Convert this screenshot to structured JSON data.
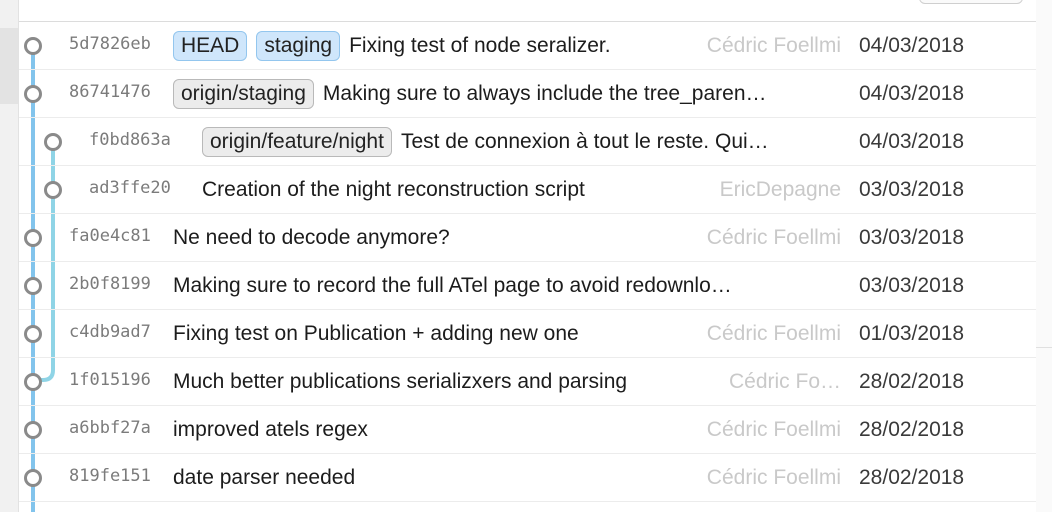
{
  "colors": {
    "lane_main": "#82c4ec",
    "lane_branch": "#8fd4e6",
    "node_stroke": "#8a8a8a",
    "badge_local_bg": "#cfe6fb",
    "badge_remote_bg": "#ececec"
  },
  "commits": [
    {
      "hash": "5d7826eb",
      "refs": [
        {
          "label": "HEAD",
          "kind": "local"
        },
        {
          "label": "staging",
          "kind": "local"
        }
      ],
      "message": "Fixing test of node seralizer.",
      "author": "Cédric Foellmi",
      "date": "04/03/2018",
      "lane": 0
    },
    {
      "hash": "86741476",
      "refs": [
        {
          "label": "origin/staging",
          "kind": "remote"
        }
      ],
      "message": "Making sure to always include the tree_paren…",
      "author": "",
      "date": "04/03/2018",
      "lane": 0
    },
    {
      "hash": "f0bd863a",
      "refs": [
        {
          "label": "origin/feature/night",
          "kind": "remote"
        }
      ],
      "message": "Test de connexion à tout le reste. Qui…",
      "author": "",
      "date": "04/03/2018",
      "lane": 1
    },
    {
      "hash": "ad3ffe20",
      "refs": [],
      "message": "Creation of the night reconstruction script",
      "author": "EricDepagne",
      "date": "03/03/2018",
      "lane": 1
    },
    {
      "hash": "fa0e4c81",
      "refs": [],
      "message": "Ne need to decode anymore?",
      "author": "Cédric Foellmi",
      "date": "03/03/2018",
      "lane": 0
    },
    {
      "hash": "2b0f8199",
      "refs": [],
      "message": "Making sure to record the full ATel page to avoid redownlo…",
      "author": "",
      "date": "03/03/2018",
      "lane": 0
    },
    {
      "hash": "c4db9ad7",
      "refs": [],
      "message": "Fixing test on Publication + adding new one",
      "author": "Cédric Foellmi",
      "date": "01/03/2018",
      "lane": 0
    },
    {
      "hash": "1f015196",
      "refs": [],
      "message": "Much better publications serializxers and parsing",
      "author": "Cédric Fo…",
      "date": "28/02/2018",
      "lane": 0
    },
    {
      "hash": "a6bbf27a",
      "refs": [],
      "message": "improved atels regex",
      "author": "Cédric Foellmi",
      "date": "28/02/2018",
      "lane": 0
    },
    {
      "hash": "819fe151",
      "refs": [],
      "message": "date parser needed",
      "author": "Cédric Foellmi",
      "date": "28/02/2018",
      "lane": 0
    }
  ]
}
